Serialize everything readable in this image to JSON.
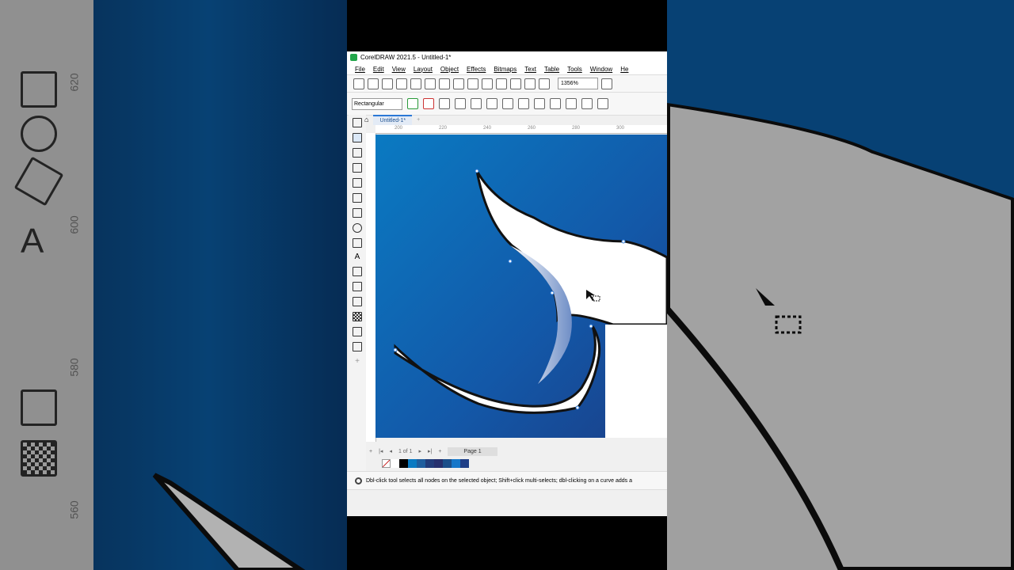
{
  "app": {
    "title": "CorelDRAW 2021.5 - Untitled-1*",
    "menu": [
      "File",
      "Edit",
      "View",
      "Layout",
      "Object",
      "Effects",
      "Bitmaps",
      "Text",
      "Table",
      "Tools",
      "Window",
      "He"
    ]
  },
  "toolbar": {
    "zoom_value": "1356%"
  },
  "property_bar": {
    "mode_select": "Rectangular"
  },
  "document": {
    "tab_label": "Untitled-1*"
  },
  "ruler": {
    "h_ticks": [
      "200",
      "220",
      "240",
      "260",
      "280",
      "300"
    ]
  },
  "pager": {
    "page_count": "1 of 1",
    "page_tab": "Page 1"
  },
  "palette": {
    "colors": [
      "#ffffff",
      "#000000",
      "#0a7ac2",
      "#1f5e9e",
      "#223c7a",
      "#26306e",
      "#1b4f8a",
      "#1677c9",
      "#1f3f87"
    ]
  },
  "status": {
    "hint": "Dbl-click tool selects all nodes on the selected object; Shift+click multi-selects; dbl-clicking on a curve adds a"
  },
  "side_labels": {
    "left_ruler": [
      "620",
      "600",
      "580",
      "560"
    ]
  }
}
